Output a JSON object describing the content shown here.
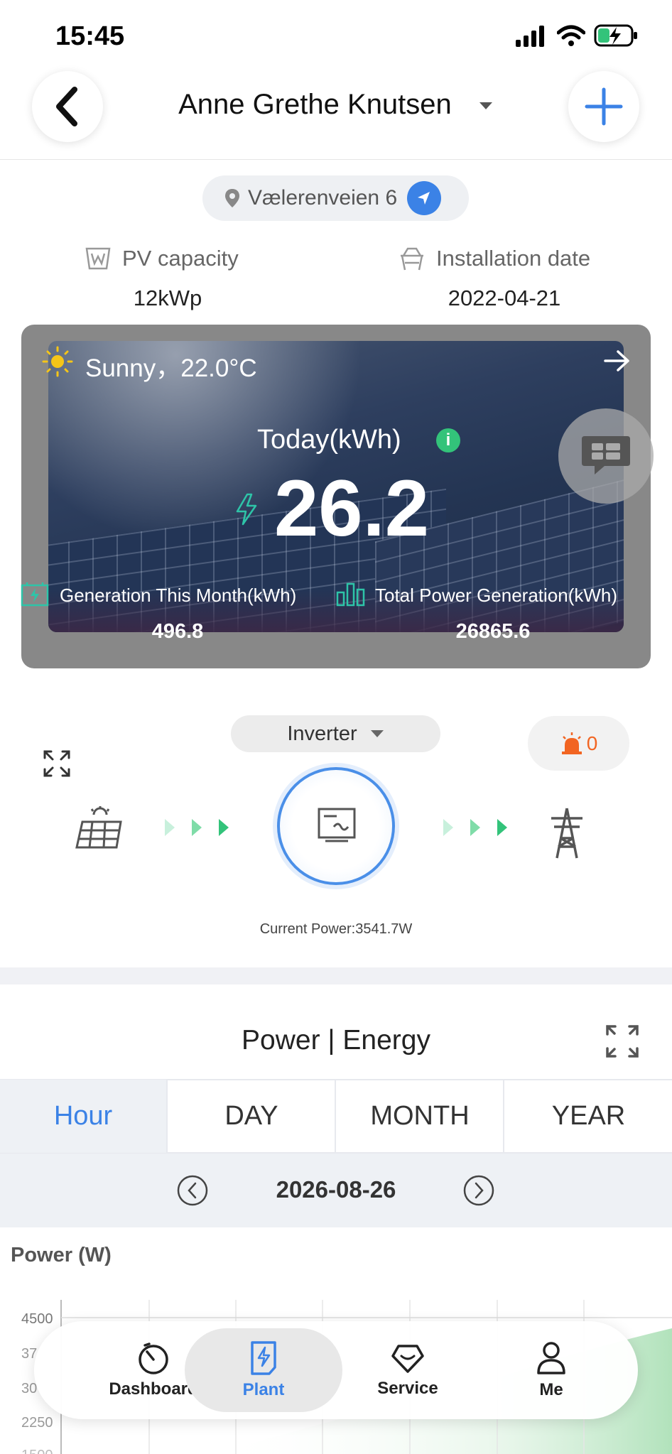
{
  "status_bar": {
    "time": "15:45"
  },
  "header": {
    "title": "Anne Grethe Knutsen"
  },
  "location": {
    "address": "Vælerenveien 6"
  },
  "stats": {
    "pv_capacity_label": "PV capacity",
    "pv_capacity_value": "12kWp",
    "install_label": "Installation date",
    "install_value": "2022-04-21"
  },
  "weather": {
    "text": "Sunny，22.0°C"
  },
  "today": {
    "label": "Today(kWh)",
    "value": "26.2"
  },
  "month": {
    "label": "Generation This Month(kWh)",
    "value": "496.8"
  },
  "total": {
    "label": "Total Power Generation(kWh)",
    "value": "26865.6"
  },
  "flow": {
    "device_selector": "Inverter",
    "alarm_count": "0",
    "current_power": "Current Power:3541.7W"
  },
  "chart_section": {
    "title": "Power | Energy",
    "tabs": [
      "Hour",
      "DAY",
      "MONTH",
      "YEAR"
    ],
    "active_tab": "Hour",
    "date": "2026-08-26",
    "ylabel": "Power (W)"
  },
  "chart_data": {
    "type": "area",
    "ylabel": "Power (W)",
    "y_ticks_visible": [
      "4500",
      "37",
      "30",
      "2250",
      "1500"
    ],
    "ylim": [
      0,
      4500
    ]
  },
  "nav": {
    "items": [
      "Dashboard",
      "Plant",
      "Service",
      "Me"
    ],
    "active": "Plant"
  },
  "colors": {
    "accent": "#3b82e6",
    "green": "#33c37a",
    "alarm": "#f26522"
  }
}
